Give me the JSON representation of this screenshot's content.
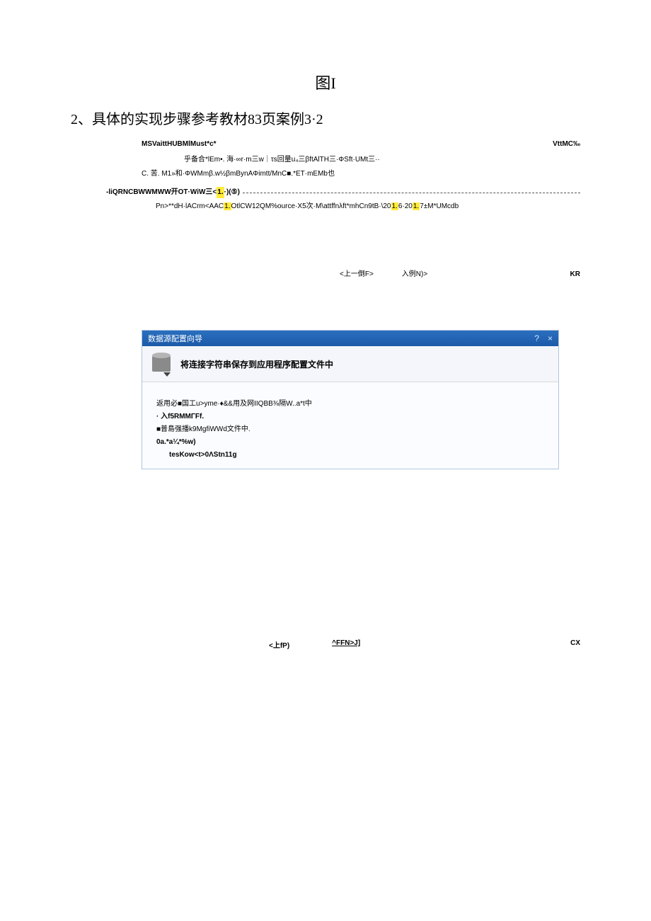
{
  "figure_label": "图I",
  "section_heading": "2、具体的实现步骤参考教材83页案例3·2",
  "upper": {
    "row1_left": "MSVaittHUBMlMust*c*",
    "row1_right": "VttMC‰",
    "line2": "乎备合*lEm•. 海·∞r·m三w｜τs回量u₄三βftAlTH三·ΦSft·UMt三··",
    "line3": "C. 苦. M1»和·ΦWMmβ.w½βmBynAΦimtt/MnC■.*ET·mEMb也",
    "dashed_prefix": "-liQRNCBWWMWW开OT·WiW三<",
    "dashed_hl": "1.",
    "dashed_suffix": "·)(⑤)",
    "line5_a": "Pn>**dH·lACrm<AAC",
    "line5_hl1": "1.",
    "line5_b": "OtlCW12QM%ource·X5次·M\\attffnλft*mhCn9tB·\\20",
    "line5_hl2": "1.",
    "line5_c": "6·20",
    "line5_hl3": "1.",
    "line5_d": "7±M*UMcdb",
    "nav": {
      "prev": "<上一倒F>",
      "next": "入例N)>",
      "right": "KR"
    }
  },
  "wizard": {
    "titlebar": "数据源配置向导",
    "help": "?",
    "close": "×",
    "header_text": "将连接字符串保存到应用程序配置文件中",
    "body": {
      "l1": "返用必■国工u>yme·♦&&用及网IIQBB⅜隔W..a*t中",
      "l2": "·  入f5RMMΓFf.",
      "l3": "■普島强播k9MgfiWWd文件中.",
      "l4": "0a.*a¼*%w)",
      "l5": "tesKow<t>0ΛStn11g"
    },
    "nav2": {
      "prev": "<上fP)",
      "next": "^FFN>J]",
      "right": "CX"
    }
  }
}
